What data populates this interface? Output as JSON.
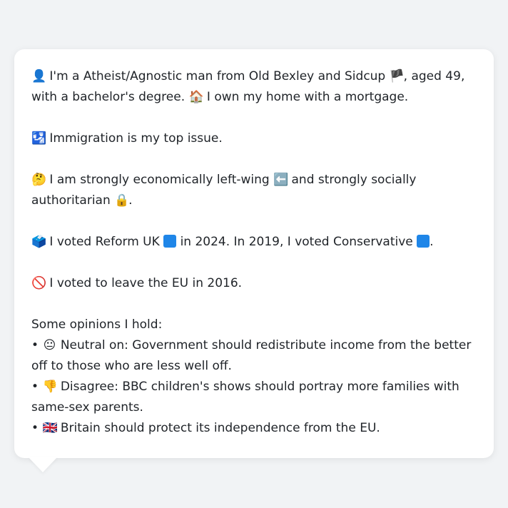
{
  "colors": {
    "background": "#f1f3f5",
    "bubble": "#ffffff",
    "text": "#1f2328",
    "reform_blue": "#1f86e8",
    "conservative_blue": "#1f86e8"
  },
  "profile": {
    "intro_icon": "👤",
    "intro_a": "I'm a Atheist/Agnostic man from Old Bexley and Sidcup",
    "england_flag_icon": "🏴",
    "intro_b": ", aged 49, with a bachelor's degree.",
    "home_icon": "🏠",
    "home_text": "I own my home with a mortgage.",
    "issue_icon": "🛂",
    "issue_text": "Immigration is my top issue.",
    "thinking_icon": "🤔",
    "ideology_a": "I am strongly economically left-wing",
    "left_arrow_icon": "⬅️",
    "ideology_b": "and strongly socially authoritarian",
    "lock_icon": "🔒",
    "ideology_end": ".",
    "ballot_icon": "🗳️",
    "vote_a": "I voted Reform UK",
    "vote_b": "in 2024. In 2019, I voted Conservative",
    "vote_end": ".",
    "brexit_icon": "🚫",
    "brexit_text": "I voted to leave the EU in 2016.",
    "opinions_heading": "Some opinions I hold:",
    "opinions": [
      {
        "bullet": "•",
        "icon": "😐",
        "text": "Neutral on: Government should redistribute income from the better off to those who are less well off."
      },
      {
        "bullet": "•",
        "icon": "👎",
        "text": "Disagree: BBC children's shows should portray more families with same-sex parents."
      },
      {
        "bullet": "•",
        "icon": "🇬🇧",
        "text": "Britain should protect its independence from the EU."
      }
    ]
  }
}
